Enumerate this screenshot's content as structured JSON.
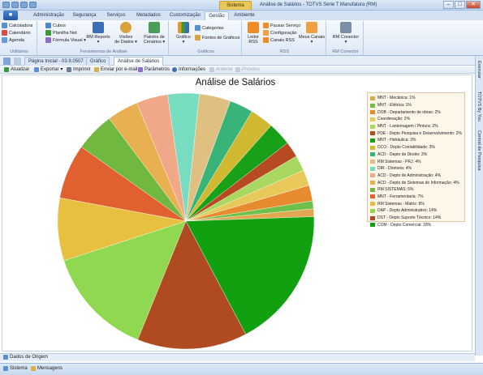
{
  "window": {
    "title": "Análise de Salários - TOTVS Série T Manufatura (RM)",
    "context_tab": "Sistema",
    "buttons": [
      "–",
      "□",
      "✕"
    ]
  },
  "ribbon": {
    "file_label": "■",
    "tabs": [
      "Administração",
      "Segurança",
      "Serviços",
      "Metadados",
      "Customização",
      "Gestão",
      "Ambiente"
    ],
    "selected_tab": "Gestão",
    "groups": {
      "utilitarios": {
        "caption": "Utilitários",
        "items": [
          "Calculadora",
          "Calendário",
          "Agenda"
        ]
      },
      "ferramentas": {
        "caption": "Ferramentas de Análise",
        "items": [
          "Cubos",
          "Planilha Net",
          "Fórmula Visual ▾"
        ],
        "big": [
          {
            "label": "RM Reports",
            "sub": "▾"
          },
          {
            "label": "Visões",
            "sub": "de Dados ▾"
          },
          {
            "label": "Painéis de",
            "sub": "Cenários ▾"
          }
        ]
      },
      "graficos": {
        "caption": "Gráficos",
        "big": [
          {
            "label": "Gráfico",
            "sub": "▾"
          }
        ],
        "items": [
          "Categorias",
          "Fontes de Gráficos"
        ]
      },
      "rss": {
        "caption": "RSS",
        "big": [
          {
            "label": "Leitor",
            "sub": "RSS"
          },
          {
            "label": "Meus Canais",
            "sub": "▾"
          }
        ],
        "items": [
          "Pausar Serviço",
          "Configuração",
          "Canais RSS"
        ]
      },
      "conector": {
        "caption": "RM Conector",
        "big": [
          {
            "label": "RM Conector",
            "sub": "▾"
          }
        ]
      }
    }
  },
  "doc_tabs": [
    "Página Inicial - 03.9.0507",
    "Gráfico",
    "Análise de Salários"
  ],
  "selected_doc_tab": "Análise de Salários",
  "toolbar": {
    "atualizar": "Atualizar",
    "exportar": "Exportar ▾",
    "imprimir": "Imprimir",
    "email": "Enviar por e-mail",
    "parametros": "Parâmetros",
    "informacoes": "Informações",
    "anterior": "Anterior",
    "proximo": "Próximo"
  },
  "sidebar": [
    "Executar",
    "TOTVS By You",
    "Central de Pesquisa"
  ],
  "bottom_panel": "Dados de Origem",
  "status": {
    "sistema": "Sistema",
    "mensagens": "Mensagens"
  },
  "chart_data": {
    "type": "pie",
    "title": "Análise de Salários",
    "legend_position": "right",
    "series": [
      {
        "name": "MNT - Mecânica: 1%",
        "value": 1,
        "color": "#e0a850"
      },
      {
        "name": "MNT - Elétrica: 1%",
        "value": 1,
        "color": "#6ec04a"
      },
      {
        "name": "DOB - Departamento de obras: 2%",
        "value": 2,
        "color": "#e88a2e"
      },
      {
        "name": "Coordenação: 2%",
        "value": 2,
        "color": "#e8c858"
      },
      {
        "name": "MNT - Lanternagem / Pintura: 2%",
        "value": 2,
        "color": "#a8d860"
      },
      {
        "name": "PDE - Depto Pesquisa e Desenvolvimento: 2%",
        "value": 2,
        "color": "#b84a22"
      },
      {
        "name": "MNT - Hidráulica: 3%",
        "value": 3,
        "color": "#18a018"
      },
      {
        "name": "DCO - Depto Contabilidade: 3%",
        "value": 3,
        "color": "#d0b830"
      },
      {
        "name": "ACD - Depto de Direito: 3%",
        "value": 3,
        "color": "#38b478"
      },
      {
        "name": "RM Sistemas - PRJ: 4%",
        "value": 4,
        "color": "#e0c080"
      },
      {
        "name": "DIR - Diretoria: 4%",
        "value": 4,
        "color": "#78dcc0"
      },
      {
        "name": "ACD - Depto de Administração: 4%",
        "value": 4,
        "color": "#f0a888"
      },
      {
        "name": "ACD - Depto de Sistemas de Informação: 4%",
        "value": 4,
        "color": "#e8b050"
      },
      {
        "name": "RM SISTEMAS: 5%",
        "value": 5,
        "color": "#70b840"
      },
      {
        "name": "MNT - Ferramentaria: 7%",
        "value": 7,
        "color": "#e06030"
      },
      {
        "name": "RM Sistemas - Matriz: 8%",
        "value": 8,
        "color": "#e8c040"
      },
      {
        "name": "DAP - Depto Administrativo: 14%",
        "value": 14,
        "color": "#90d850"
      },
      {
        "name": "DST - Depto Suporte Técnico: 14%",
        "value": 14,
        "color": "#b04a20"
      },
      {
        "name": "COM - Depto Comercial: 18%",
        "value": 18,
        "color": "#10a010"
      }
    ]
  }
}
